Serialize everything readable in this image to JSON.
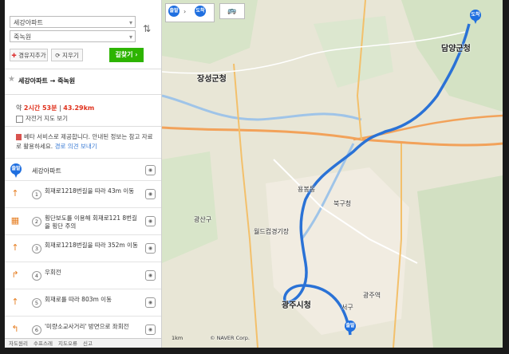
{
  "search": {
    "start_value": "세강아파트",
    "end_value": "죽녹원",
    "add_waypoint": "경유지추가",
    "clear": "지우기",
    "go": "길찾기 ›"
  },
  "route": {
    "title": "세강아파트 → 죽녹원",
    "summary_prefix": "약 ",
    "time": "2시간 53분",
    "dist_sep": " | ",
    "distance": "43.29km",
    "bike_map": "자전거 지도 보기",
    "notice": "베타 서비스로 제공합니다. 안내된 정보는 참고 자료로 활용하세요.",
    "notice_link": "경로 의견 보내기"
  },
  "origin": {
    "label": "세강아파트",
    "pin": "출발"
  },
  "steps": [
    {
      "num": "1",
      "icon": "arrow-up-icon",
      "glyph": "↑",
      "text": "회재로1218번길을 따라 43m 이동"
    },
    {
      "num": "2",
      "icon": "crosswalk-icon",
      "glyph": "▦",
      "text": "횡단보도를 이용해 회재로121 8번길을 횡단 주의"
    },
    {
      "num": "3",
      "icon": "arrow-up-icon",
      "glyph": "↑",
      "text": "회재로1218번길을 따라 352m 이동"
    },
    {
      "num": "4",
      "icon": "turn-right-icon",
      "glyph": "↱",
      "text": "우회전"
    },
    {
      "num": "5",
      "icon": "arrow-up-icon",
      "glyph": "↑",
      "text": "회재로를 따라 803m 이동"
    },
    {
      "num": "6",
      "icon": "turn-left-icon",
      "glyph": "↰",
      "text": "'미량소교사거리' 방면으로 좌회전"
    }
  ],
  "footer": [
    "자도원리",
    "수프스레",
    "지도오류",
    "신고"
  ],
  "map": {
    "pins": {
      "start": "출발",
      "end": "도착"
    },
    "labels": {
      "jangseong": "장성군청",
      "damyang": "담양군청",
      "gwangju": "광주시청",
      "bukgu": "북구청",
      "gwangjuyeok": "광주역",
      "world_cup": "월드컵경기장",
      "yongbong": "용봉동",
      "gwangsan": "광산구",
      "seogu": "서구"
    },
    "scale": "1km",
    "copyright": "© NAVER Corp."
  }
}
